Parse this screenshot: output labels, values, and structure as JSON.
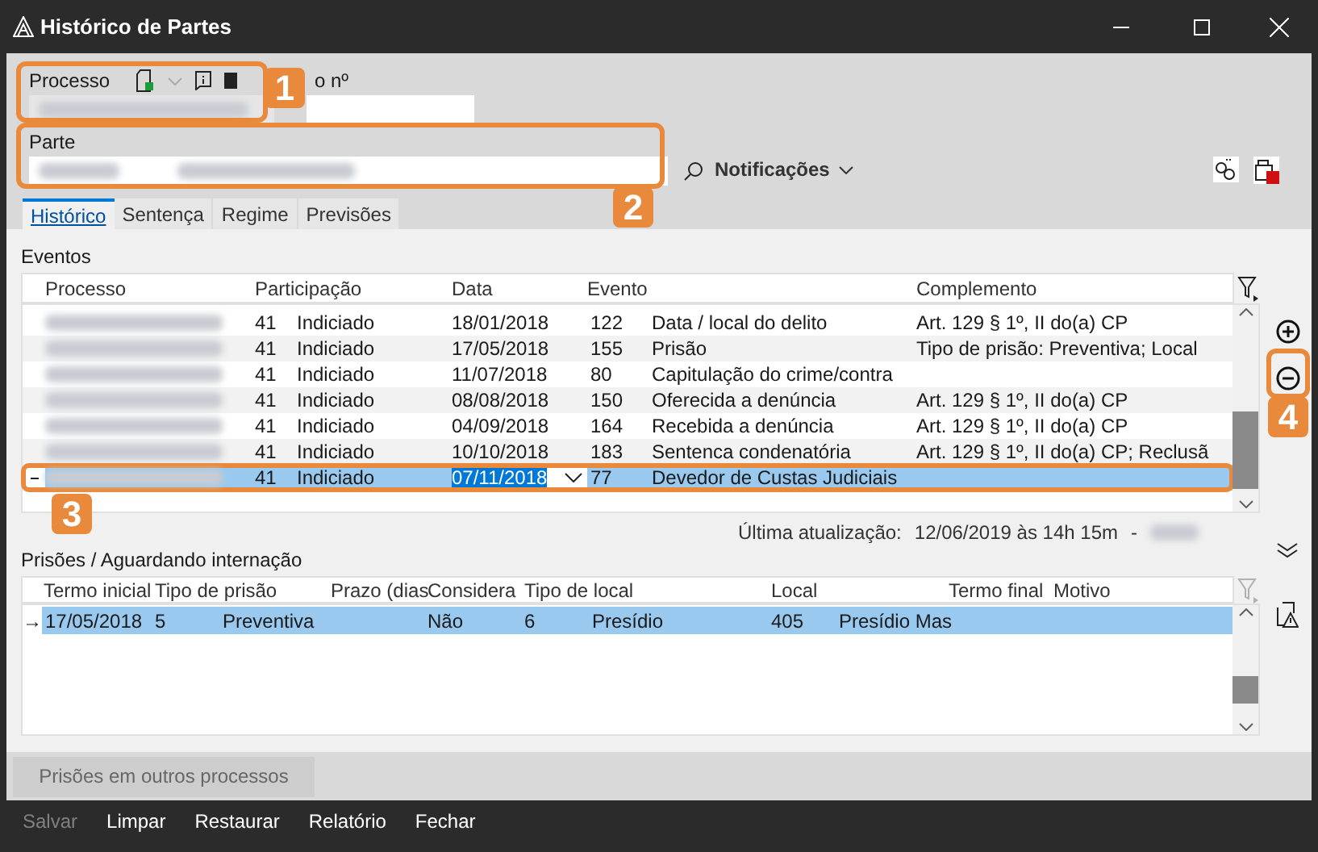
{
  "window": {
    "title": "Histórico de Partes"
  },
  "header": {
    "processo_label": "Processo",
    "numero_label": "o nº",
    "parte_label": "Parte",
    "notifications": "Notificações"
  },
  "tabs": [
    {
      "label": "Histórico",
      "selected": true
    },
    {
      "label": "Sentença",
      "selected": false
    },
    {
      "label": "Regime",
      "selected": false
    },
    {
      "label": "Previsões",
      "selected": false
    }
  ],
  "events": {
    "label": "Eventos",
    "columns": [
      "Processo",
      "Participação",
      "Data",
      "Evento",
      "Complemento"
    ],
    "rows": [
      {
        "participacao_code": "41",
        "participacao": "Indiciado",
        "data": "18/01/2018",
        "evento_code": "122",
        "evento": "Data / local do delito",
        "complemento": "Art. 129 § 1º, II do(a) CP",
        "selected": false
      },
      {
        "participacao_code": "41",
        "participacao": "Indiciado",
        "data": "17/05/2018",
        "evento_code": "155",
        "evento": "Prisão",
        "complemento": "Tipo de prisão: Preventiva; Local",
        "selected": false
      },
      {
        "participacao_code": "41",
        "participacao": "Indiciado",
        "data": "11/07/2018",
        "evento_code": "80",
        "evento": "Capitulação do crime/contra",
        "selected": false
      },
      {
        "participacao_code": "41",
        "participacao": "Indiciado",
        "data": "08/08/2018",
        "evento_code": "150",
        "evento": "Oferecida a denúncia",
        "complemento": "Art. 129 § 1º, II do(a) CP",
        "selected": false
      },
      {
        "participacao_code": "41",
        "participacao": "Indiciado",
        "data": "04/09/2018",
        "evento_code": "164",
        "evento": "Recebida a denúncia",
        "complemento": "Art. 129 § 1º, II do(a) CP",
        "selected": false
      },
      {
        "participacao_code": "41",
        "participacao": "Indiciado",
        "data": "10/10/2018",
        "evento_code": "183",
        "evento": "Sentenca condenatória",
        "complemento": "Art. 129 § 1º, II do(a) CP; Reclusã",
        "selected": false
      },
      {
        "participacao_code": "41",
        "participacao": "Indiciado",
        "data": "07/11/2018",
        "evento_code": "77",
        "evento": "Devedor de Custas Judiciais",
        "selected": true
      }
    ]
  },
  "last_update": {
    "label": "Última atualização:",
    "value": "12/06/2019 às 14h 15m",
    "separator": "-"
  },
  "prisoes": {
    "label": "Prisões / Aguardando internação",
    "columns": [
      "Termo inicial",
      "Tipo de prisão",
      "Prazo (dias",
      "Considera",
      "Tipo de local",
      "Local",
      "Termo final",
      "Motivo"
    ],
    "rows": [
      {
        "indicator": "→",
        "termo_inicial": "17/05/2018",
        "tipo_code": "5",
        "tipo": "Preventiva",
        "considera": "Não",
        "tipo_local_code": "6",
        "tipo_local": "Presídio",
        "local_code": "405",
        "local": "Presídio Mas",
        "selected": true
      }
    ]
  },
  "other_button": {
    "label": "Prisões em outros processos",
    "disabled": true
  },
  "footer": [
    {
      "label": "Salvar",
      "disabled": true
    },
    {
      "label": "Limpar",
      "disabled": false
    },
    {
      "label": "Restaurar",
      "disabled": false
    },
    {
      "label": "Relatório",
      "disabled": false
    },
    {
      "label": "Fechar",
      "disabled": false
    }
  ],
  "callouts": [
    {
      "number": "1"
    },
    {
      "number": "2"
    },
    {
      "number": "3"
    },
    {
      "number": "4"
    }
  ]
}
